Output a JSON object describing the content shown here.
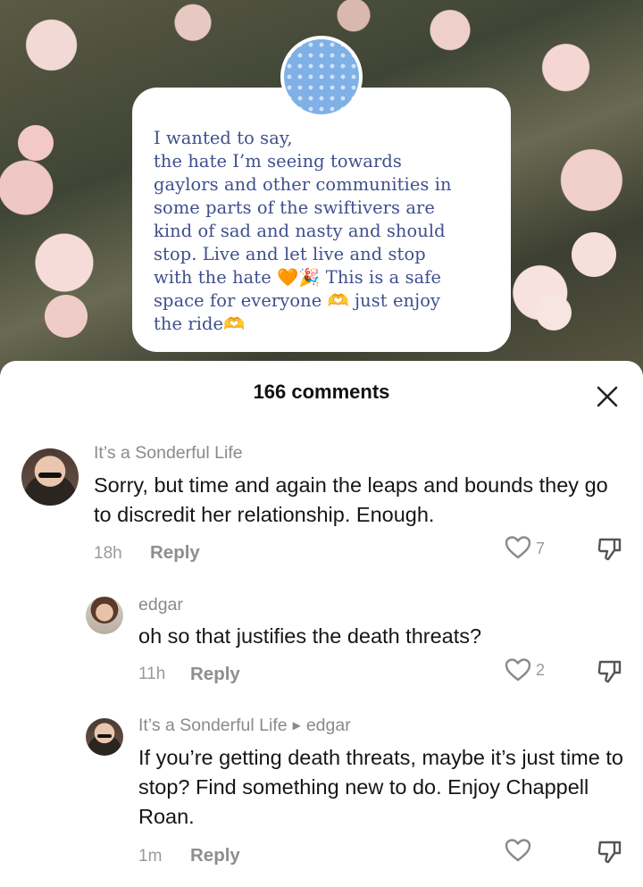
{
  "post": {
    "text_lines": [
      "I wanted to say,",
      "the hate I’m seeing towards",
      "gaylors and other communities in",
      "some parts of the swiftivers are",
      "kind of sad and nasty and should",
      "stop. Live and let live and stop",
      "with the hate 🧡🎉 This is a safe",
      "space for everyone 🫶 just enjoy",
      "the ride🫶"
    ]
  },
  "comments_header": {
    "title": "166 comments",
    "close_icon": "close-icon"
  },
  "comments": [
    {
      "username": "It’s a Sonderful Life",
      "text": "Sorry, but time and again the leaps and bounds they go to discredit her relationship. Enough.",
      "time": "18h",
      "reply_label": "Reply",
      "likes": "7"
    },
    {
      "username": "edgar",
      "text": "oh so that justifies the death threats?",
      "time": "11h",
      "reply_label": "Reply",
      "likes": "2"
    },
    {
      "username": "It’s a Sonderful Life",
      "reply_to": "edgar",
      "text": "If you’re getting death threats, maybe it’s just time to stop? Find something new to do. Enjoy Chappell Roan.",
      "time": "1m",
      "reply_label": "Reply",
      "likes": ""
    }
  ],
  "colors": {
    "post_text": "#3f4f8e",
    "badge": "#7fb0e6",
    "muted": "#8a8a8a"
  }
}
